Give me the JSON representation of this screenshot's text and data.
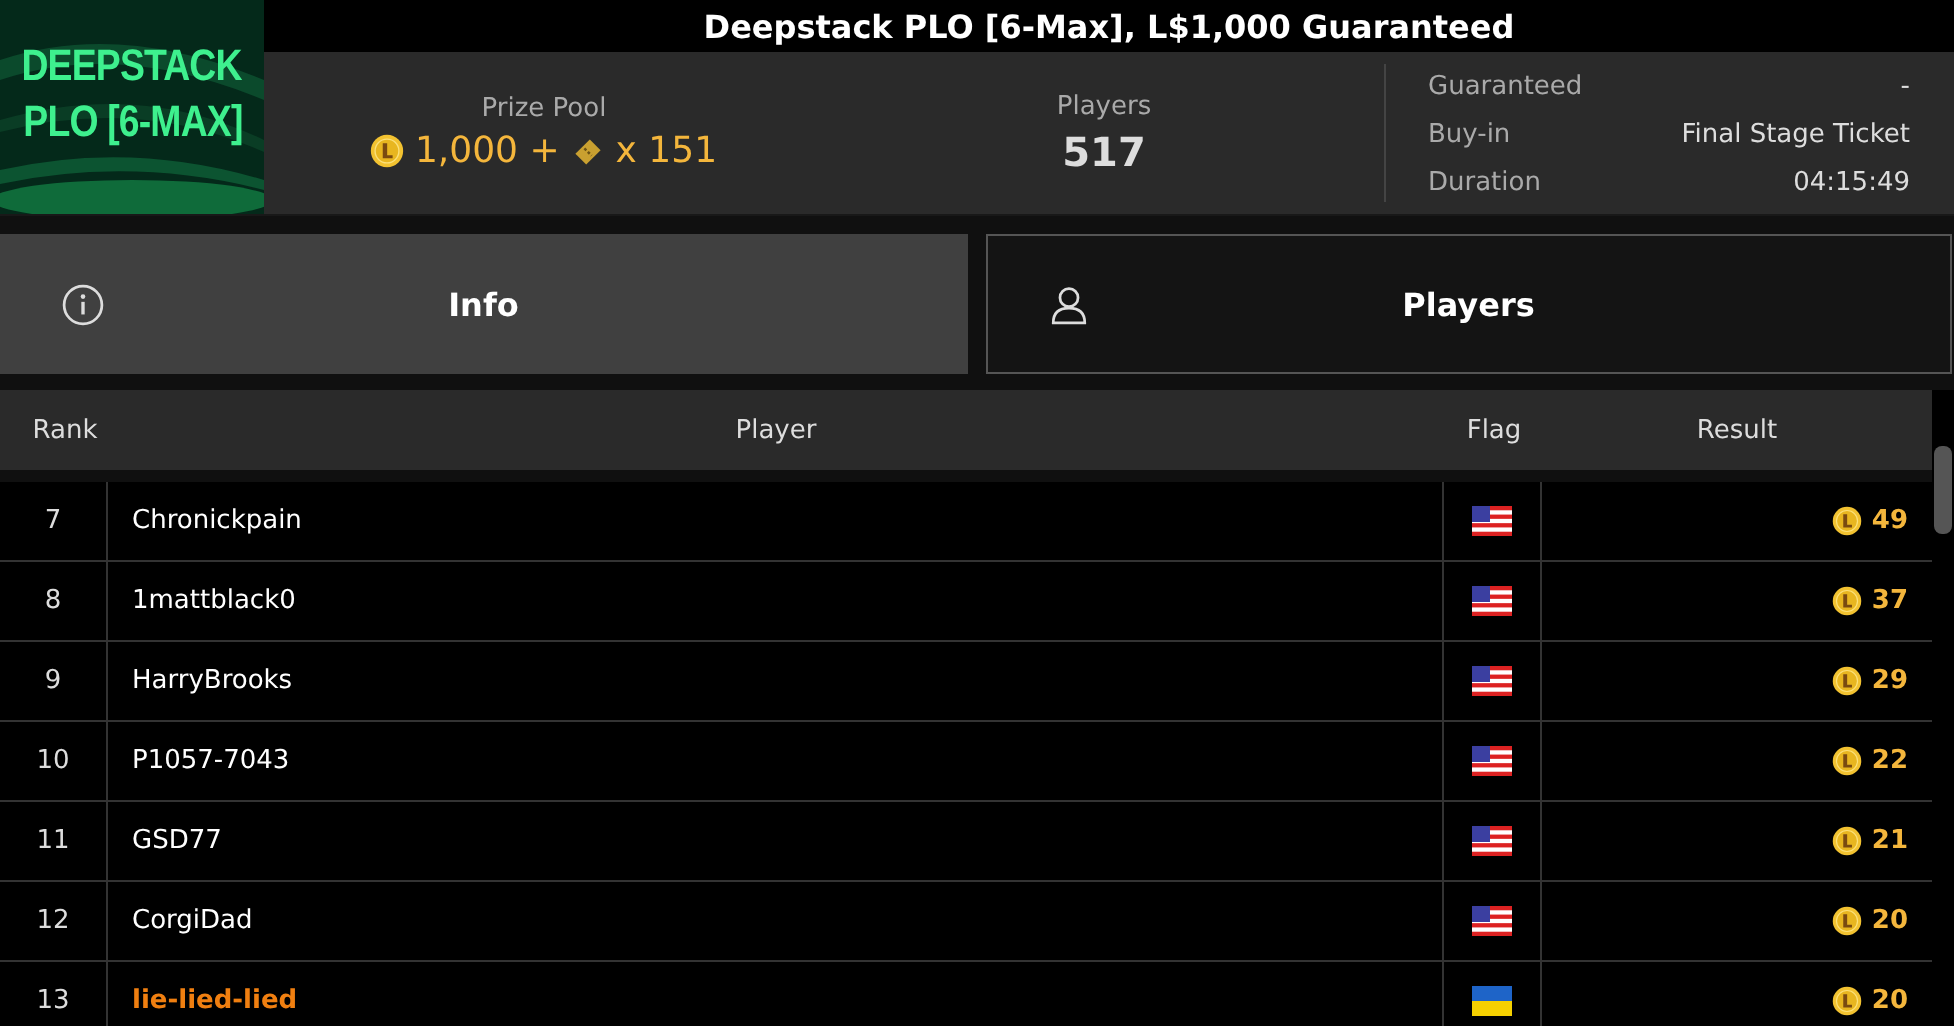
{
  "window": {
    "title": "Deepstack PLO [6-Max], L$1,000 Guaranteed"
  },
  "banner": {
    "lines": [
      "DEEPSTACK",
      "PLO [6-MAX]"
    ]
  },
  "summary": {
    "prize_pool": {
      "label": "Prize Pool",
      "amount": "1,000 +",
      "tickets": "x 151"
    },
    "players": {
      "label": "Players",
      "value": "517"
    },
    "details": [
      {
        "label": "Guaranteed",
        "value": "-"
      },
      {
        "label": "Buy-in",
        "value": "Final Stage Ticket"
      },
      {
        "label": "Duration",
        "value": "04:15:49"
      }
    ]
  },
  "tabs": [
    {
      "label": "Info",
      "kind": "info",
      "selected": true
    },
    {
      "label": "Players",
      "kind": "user",
      "selected": false
    }
  ],
  "table": {
    "columns": [
      "Rank",
      "Player",
      "Flag",
      "Result"
    ],
    "rows": [
      {
        "rank": "7",
        "player": "Chronickpain",
        "kind": "us",
        "result": "49",
        "highlighted": false
      },
      {
        "rank": "8",
        "player": "1mattblack0",
        "kind": "us",
        "result": "37",
        "highlighted": false
      },
      {
        "rank": "9",
        "player": "HarryBrooks",
        "kind": "us",
        "result": "29",
        "highlighted": false
      },
      {
        "rank": "10",
        "player": "P1057-7043",
        "kind": "us",
        "result": "22",
        "highlighted": false
      },
      {
        "rank": "11",
        "player": "GSD77",
        "kind": "us",
        "result": "21",
        "highlighted": false
      },
      {
        "rank": "12",
        "player": "CorgiDad",
        "kind": "us",
        "result": "20",
        "highlighted": false
      },
      {
        "rank": "13",
        "player": "lie-lied-lied",
        "kind": "ua",
        "result": "20",
        "highlighted": true
      }
    ]
  }
}
